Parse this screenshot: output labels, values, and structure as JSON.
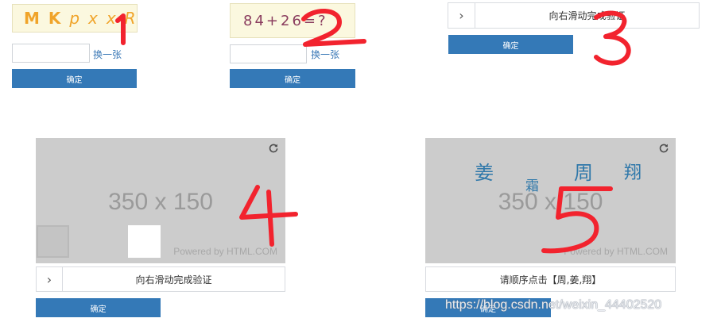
{
  "panel1": {
    "captcha": {
      "chars": [
        "M",
        "K",
        "p",
        "x",
        "x",
        "R"
      ]
    },
    "refresh_label": "换一张",
    "confirm_label": "确定"
  },
  "panel2": {
    "captcha": {
      "text": "84+26=?"
    },
    "refresh_label": "换一张",
    "confirm_label": "确定"
  },
  "panel3": {
    "slider_label": "向右滑动完成验证",
    "confirm_label": "确定"
  },
  "panel4": {
    "placeholder": "350 x 150",
    "powered": "Powered by HTML.COM",
    "slider_label": "向右滑动完成验证",
    "confirm_label": "确定"
  },
  "panel5": {
    "placeholder": "350 x 150",
    "powered": "Powered by HTML.COM",
    "chars": [
      "姜",
      "霜",
      "周",
      "翔"
    ],
    "instruction": "请顺序点击【周,姜,翔】",
    "confirm_label": "确定"
  },
  "annotations": [
    "1",
    "2",
    "3",
    "4",
    "5"
  ],
  "watermark": "https://blog.csdn.net/weixin_44402520",
  "colors": {
    "primary_button": "#3479b7",
    "link": "#3a78b6",
    "annotation": "#f2232e",
    "placeholder_bg": "#cccccc"
  }
}
